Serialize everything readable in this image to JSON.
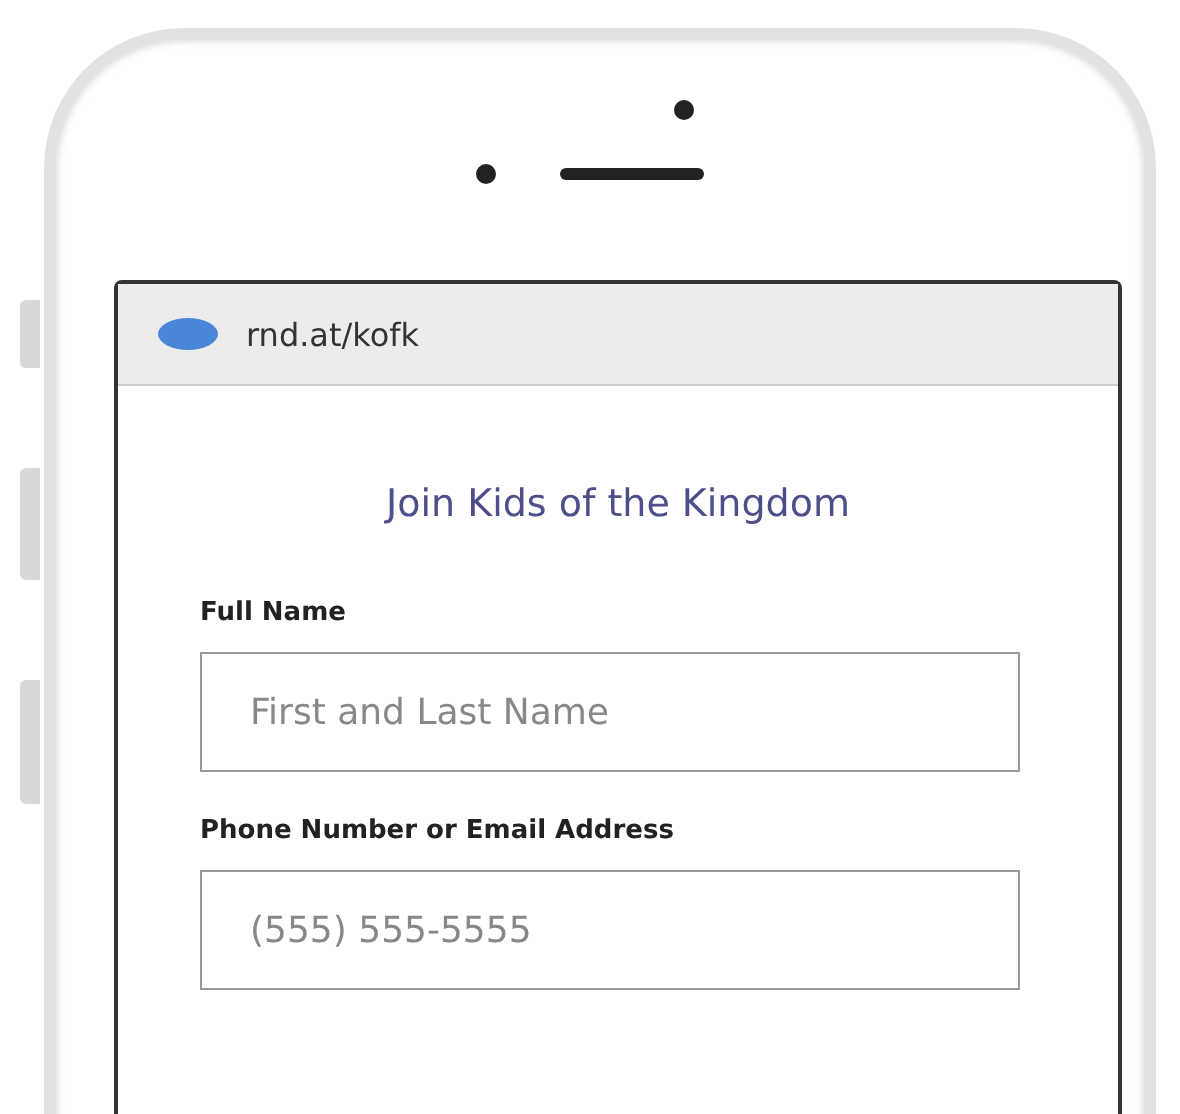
{
  "browser": {
    "url": "rnd.at/kofk"
  },
  "form": {
    "title": "Join Kids of the Kingdom",
    "fields": [
      {
        "label": "Full Name",
        "placeholder": "First and Last Name"
      },
      {
        "label": "Phone Number or Email Address",
        "placeholder": "(555) 555-5555"
      }
    ]
  }
}
